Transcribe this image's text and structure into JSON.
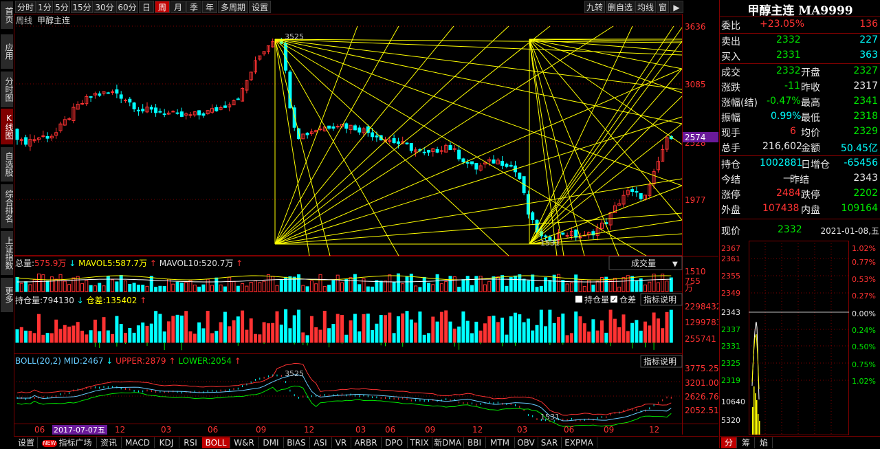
{
  "left_nav": [
    "首页",
    "应用",
    "分时图",
    "K线图",
    "自选股",
    "综合排名",
    "上证指数",
    "更多"
  ],
  "toolbar": {
    "periods": [
      "分时",
      "1分",
      "5分",
      "15分",
      "30分",
      "60分",
      "日",
      "周",
      "月",
      "季",
      "年",
      "多周期",
      "设置"
    ],
    "active_period": "周",
    "right_items": [
      "九转",
      "删自选",
      "均线",
      "窗"
    ]
  },
  "chart": {
    "period_label": "周线",
    "instrument": "甲醇主连",
    "price_axis": [
      "3636",
      "3085",
      "2574",
      "2528",
      "1977"
    ],
    "current_price_tag": "2574",
    "high_mark": "3525",
    "low_mark": "1531",
    "volume_header": {
      "total_label": "总量:",
      "total_value": "575.9万",
      "ma5_label": "MAVOL5:",
      "ma5_value": "587.7万",
      "ma10_label": "MAVOL10:",
      "ma10_value": "520.7万",
      "dropdown": "成交量"
    },
    "volume_axis": [
      "1510",
      "755",
      "万"
    ],
    "oi_header": {
      "label": "持仓量:",
      "value": "794130",
      "diff_label": "仓差:",
      "diff_value": "135402",
      "chk1": "持仓量",
      "chk2": "仓差",
      "explain": "指标说明"
    },
    "oi_axis": [
      "2298432",
      "1299783",
      "255741"
    ],
    "boll_header": {
      "label": "BOLL(20,2) MID:",
      "mid": "2467",
      "upper_label": "UPPER:",
      "upper": "2879",
      "lower_label": "LOWER:",
      "lower": "2054",
      "explain": "指标说明"
    },
    "boll_axis": [
      "3775.25",
      "3201.00",
      "2626.76",
      "2052.51"
    ],
    "boll_high": "3525",
    "boll_low": "1531",
    "x_axis": [
      "06",
      "12",
      "03",
      "06",
      "09",
      "12",
      "03",
      "06",
      "09",
      "12",
      "03",
      "06",
      "09",
      "12"
    ],
    "cursor_date": "2017-07-07五"
  },
  "quote": {
    "title": "甲醇主连 MA9999",
    "weibi_label": "委比",
    "weibi": "+23.05%",
    "weibi_n": "136",
    "sell_label": "卖出",
    "sell": "2332",
    "sell_n": "227",
    "buy_label": "买入",
    "buy": "2331",
    "buy_n": "363",
    "deal_label": "成交",
    "deal": "2332",
    "open_label": "开盘",
    "open": "2327",
    "change_label": "涨跌",
    "change": "-11",
    "prevclose_label": "昨收",
    "prevclose": "2317",
    "pct_label": "涨幅(结)",
    "pct": "-0.47%",
    "high_label": "最高",
    "high": "2341",
    "amp_label": "振幅",
    "amp": "0.99%",
    "low_label": "最低",
    "low": "2318",
    "hand_label": "现手",
    "hand": "6",
    "avg_label": "均价",
    "avg": "2329",
    "total_label": "总手",
    "total": "216,602",
    "amount_label": "金额",
    "amount": "50.45亿",
    "oi_label": "持仓",
    "oi": "1002881",
    "daily_inc_label": "日增仓",
    "daily_inc": "-65456",
    "settle_label": "今结",
    "settle": "—",
    "prev_settle_label": "昨结",
    "prev_settle": "2343",
    "limitup_label": "涨停",
    "limitup": "2484",
    "limitdown_label": "跌停",
    "limitdown": "2202",
    "outer_label": "外盘",
    "outer": "107438",
    "inner_label": "内盘",
    "inner": "109164"
  },
  "mini": {
    "price_label": "现价",
    "price": "2332",
    "date": "2021-01-08,五",
    "left_axis": [
      "2367",
      "2361",
      "2355",
      "2349",
      "2343",
      "2337",
      "2331",
      "2325",
      "2319",
      "10640",
      "5320"
    ],
    "right_axis": [
      "1.02%",
      "0.77%",
      "0.53%",
      "0.27%",
      "0.00%",
      "0.24%",
      "0.50%",
      "0.75%",
      "1.02%"
    ],
    "tabs": [
      "分",
      "筹",
      "焰"
    ]
  },
  "bottom_tabs": [
    "设置",
    "指标广场",
    "资讯",
    "MACD",
    "KDJ",
    "RSI",
    "BOLL",
    "W&R",
    "DMI",
    "BIAS",
    "ASI",
    "VR",
    "ARBR",
    "DPO",
    "TRIX",
    "新DMA",
    "BBI",
    "MTM",
    "OBV",
    "SAR",
    "EXPMA"
  ],
  "active_bottom_tab": "BOLL",
  "new_badge": "NEW",
  "colors": {
    "up": "#ff3232",
    "down": "#00ffff",
    "gann": "#ffff00",
    "grid": "#800000",
    "boll_mid": "#66ccff",
    "boll_upper": "#ff3232",
    "boll_lower": "#00e600"
  }
}
